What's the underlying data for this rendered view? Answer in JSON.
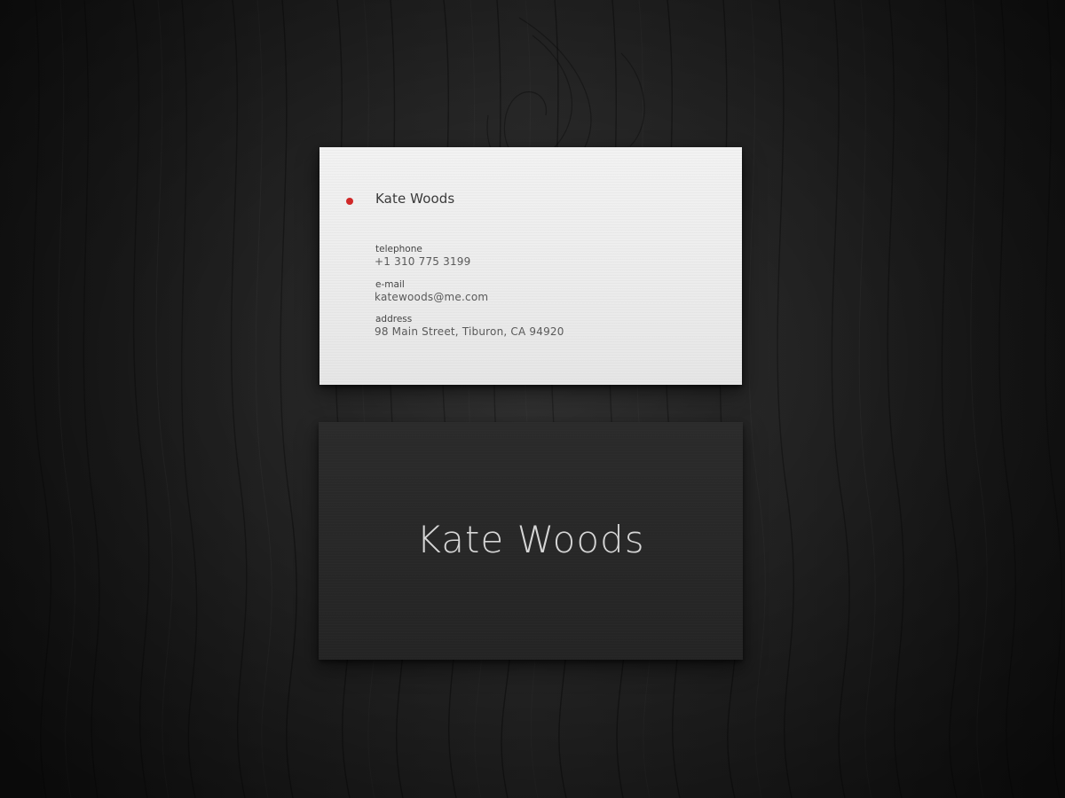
{
  "scene": {
    "background_color": "#1c1c1c",
    "surface": "dark wood"
  },
  "front_card": {
    "name": "Kate Woods",
    "accent_color": "#d02828",
    "telephone_label": "telephone",
    "telephone_value": "+1 310 775 3199",
    "email_label": "e-mail",
    "email_value": "katewoods@me.com",
    "address_label": "address",
    "address_value": "98 Main Street, Tiburon, CA 94920"
  },
  "back_card": {
    "name": "Kate Woods"
  }
}
